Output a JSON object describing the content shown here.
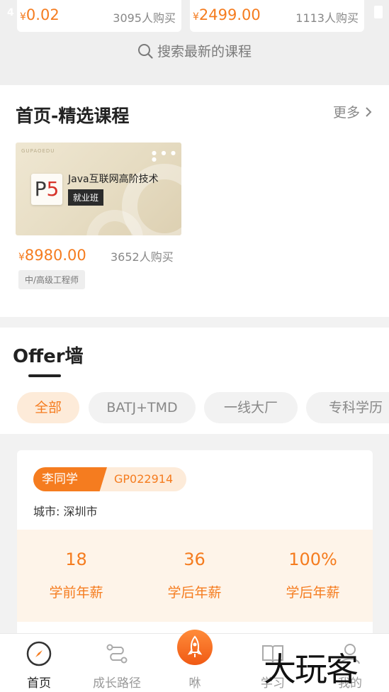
{
  "status_bar": {
    "left_partial": "4",
    "right_partial": ""
  },
  "top_cards": [
    {
      "price_symbol": "¥",
      "price": "0.02",
      "buyers": "3095人购买"
    },
    {
      "price_symbol": "¥",
      "price": "2499.00",
      "buyers": "1113人购买"
    }
  ],
  "search": {
    "hint": "搜索最新的课程",
    "icon": "search-icon"
  },
  "featured": {
    "title": "首页-精选课程",
    "more_label": "更多",
    "course": {
      "brand": "GUPAOEDU",
      "logo_text_p": "P",
      "logo_text_5": "5",
      "name": "Java互联网高阶技术",
      "tag": "就业班",
      "price_symbol": "¥",
      "price": "8980.00",
      "buyers": "3652人购买",
      "level": "中/高级工程师"
    }
  },
  "offer_wall": {
    "title": "Offer墙",
    "chips": [
      "全部",
      "BATJ+TMD",
      "一线大厂",
      "专科学历"
    ],
    "active_chip": "全部",
    "card": {
      "name": "李同学",
      "code": "GP022914",
      "city": "城市: 深圳市",
      "stats": [
        {
          "value": "18",
          "label": "学前年薪"
        },
        {
          "value": "36",
          "label": "学后年薪"
        },
        {
          "value": "100%",
          "label": "学后年薪"
        }
      ]
    }
  },
  "tabbar": {
    "items": [
      {
        "label": "首页",
        "icon": "compass-icon",
        "active": true
      },
      {
        "label": "成长路径",
        "icon": "path-icon",
        "active": false
      },
      {
        "label": "咻",
        "icon": "rocket-icon",
        "active": false
      },
      {
        "label": "学习",
        "icon": "book-icon",
        "active": false
      },
      {
        "label": "我的",
        "icon": "user-icon",
        "active": false
      }
    ]
  },
  "watermark": "大玩客",
  "colors": {
    "accent": "#f57c1f",
    "accent_light": "#fdebd9",
    "stats_bg": "#fef4e9"
  }
}
